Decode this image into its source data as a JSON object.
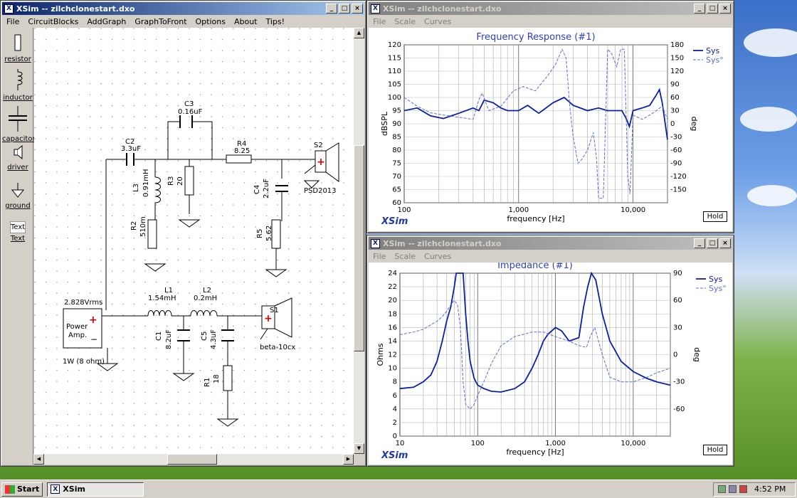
{
  "schematic_window": {
    "title": "XSim -- zilchclonestart.dxo",
    "menu": [
      "File",
      "CircuitBlocks",
      "AddGraph",
      "GraphToFront",
      "Options",
      "About",
      "Tips!"
    ],
    "palette": [
      "resistor",
      "inductor",
      "capacitor",
      "driver",
      "ground",
      "Text"
    ],
    "palette_text_box": "Text",
    "components": {
      "C2": {
        "name": "C2",
        "value": "3.3uF"
      },
      "C3": {
        "name": "C3",
        "value": "0.16uF"
      },
      "R4": {
        "name": "R4",
        "value": "8.25"
      },
      "L3": {
        "name": "L3",
        "value": "0.91mH"
      },
      "R3": {
        "name": "R3",
        "value": "20"
      },
      "R2": {
        "name": "R2",
        "value": "510m"
      },
      "C4": {
        "name": "C4",
        "value": "2.2uF"
      },
      "R5": {
        "name": "R5",
        "value": "5.62"
      },
      "S2": {
        "name": "S2",
        "value": "PSD2013"
      },
      "L1": {
        "name": "L1",
        "value": "1.54mH"
      },
      "L2": {
        "name": "L2",
        "value": "0.2mH"
      },
      "C1": {
        "name": "C1",
        "value": "8.2uF"
      },
      "C5": {
        "name": "C5",
        "value": "4.3uF"
      },
      "R1": {
        "name": "R1",
        "value": "18"
      },
      "S1": {
        "name": "S1",
        "value": "beta-10cx"
      }
    },
    "amp": {
      "voltage": "2.828Vrms",
      "label1": "Power",
      "label2": "Amp.",
      "rating": "1W (8 ohm)",
      "plus": "+",
      "minus": "−"
    }
  },
  "freq_window": {
    "title": "XSim -- zilchclonestart.dxo",
    "menu": [
      "File",
      "Scale",
      "Curves"
    ],
    "hold": "Hold",
    "logo": "XSim"
  },
  "imp_window": {
    "title": "XSim -- zilchclonestart.dxo",
    "menu": [
      "File",
      "Scale",
      "Curves"
    ],
    "hold": "Hold",
    "logo": "XSim"
  },
  "taskbar": {
    "start": "Start",
    "task": "XSim",
    "clock": "4:52 PM"
  },
  "chart_data": [
    {
      "type": "line",
      "title": "Frequency Response (#1)",
      "xlabel": "frequency [Hz]",
      "ylabel": "dBSPL",
      "y2label": "deg",
      "xscale": "log",
      "xlim": [
        100,
        20000
      ],
      "ylim": [
        60,
        120
      ],
      "y2lim": [
        -180,
        180
      ],
      "x_ticks": [
        "100",
        "1,000",
        "10,000"
      ],
      "y_ticks": [
        "60",
        "65",
        "70",
        "75",
        "80",
        "85",
        "90",
        "95",
        "100",
        "105",
        "110",
        "115",
        "120"
      ],
      "y2_ticks": [
        "-150",
        "-120",
        "-90",
        "-60",
        "-30",
        "0",
        "30",
        "60",
        "90",
        "120",
        "150",
        "180"
      ],
      "legend_position": "top-right",
      "series": [
        {
          "name": "Sys",
          "axis": "left",
          "style": "solid",
          "x": [
            100,
            130,
            170,
            220,
            300,
            400,
            450,
            500,
            600,
            700,
            800,
            1000,
            1200,
            1500,
            2000,
            2500,
            3000,
            4000,
            5000,
            6000,
            7000,
            8000,
            8700,
            9300,
            10000,
            12000,
            14000,
            16000,
            17000,
            18000,
            20000
          ],
          "y": [
            95,
            96,
            93,
            92,
            94,
            96,
            95,
            99,
            98,
            96,
            95,
            95,
            97,
            94,
            98,
            100,
            97,
            95,
            96,
            95,
            95,
            95,
            92,
            89,
            95,
            96,
            97,
            101,
            103,
            98,
            84
          ]
        },
        {
          "name": "Sys°",
          "axis": "right",
          "style": "dashed",
          "x": [
            100,
            130,
            170,
            220,
            300,
            400,
            450,
            480,
            550,
            700,
            900,
            1100,
            1400,
            1800,
            2100,
            2400,
            2600,
            2800,
            3000,
            3300,
            3600,
            4000,
            4500,
            4800,
            5000,
            5500,
            6000,
            6500,
            7200,
            7800,
            8400,
            9000,
            9400,
            10000,
            12000,
            14000,
            16000,
            18000,
            20000
          ],
          "y": [
            60,
            40,
            25,
            20,
            15,
            10,
            55,
            70,
            30,
            40,
            75,
            85,
            75,
            110,
            135,
            170,
            150,
            40,
            -30,
            -90,
            -80,
            -60,
            -20,
            -80,
            -170,
            -170,
            170,
            160,
            130,
            170,
            170,
            -120,
            -160,
            20,
            10,
            20,
            30,
            40,
            10
          ]
        }
      ]
    },
    {
      "type": "line",
      "title": "Impedance (#1)",
      "xlabel": "frequency [Hz]",
      "ylabel": "Ohms",
      "y2label": "deg",
      "xscale": "log",
      "xlim": [
        10,
        30000
      ],
      "ylim": [
        0,
        24
      ],
      "y2lim": [
        -90,
        90
      ],
      "x_ticks": [
        "10",
        "100",
        "1,000",
        "10,000"
      ],
      "y_ticks": [
        "0",
        "2",
        "4",
        "6",
        "8",
        "10",
        "12",
        "14",
        "16",
        "18",
        "20",
        "22",
        "24"
      ],
      "y2_ticks": [
        "-60",
        "-30",
        "0",
        "30",
        "60",
        "90"
      ],
      "legend_position": "top-right",
      "series": [
        {
          "name": "Sys",
          "axis": "left",
          "style": "solid",
          "x": [
            10,
            15,
            20,
            25,
            30,
            35,
            40,
            45,
            50,
            53,
            55,
            60,
            65,
            70,
            75,
            80,
            90,
            100,
            120,
            150,
            200,
            300,
            400,
            500,
            600,
            700,
            800,
            1000,
            1200,
            1500,
            2000,
            2300,
            2600,
            2900,
            3300,
            4000,
            5000,
            7000,
            10000,
            15000,
            20000,
            30000
          ],
          "y": [
            7,
            7.2,
            8,
            9,
            11,
            14,
            17,
            19,
            22,
            24,
            24,
            24,
            24,
            18,
            14,
            11,
            8.5,
            7.5,
            7,
            6.6,
            6.5,
            7,
            8,
            10,
            12,
            14,
            15,
            16,
            15.5,
            14,
            14.5,
            19,
            22,
            24,
            23,
            18,
            14,
            11,
            9.5,
            8.5,
            8,
            7.5
          ]
        },
        {
          "name": "Sys°",
          "axis": "right",
          "style": "dashed",
          "x": [
            10,
            15,
            20,
            25,
            30,
            35,
            40,
            45,
            50,
            55,
            60,
            65,
            70,
            80,
            90,
            100,
            120,
            150,
            200,
            300,
            500,
            700,
            1000,
            1500,
            2000,
            2500,
            2800,
            3200,
            4000,
            5000,
            7000,
            10000,
            15000,
            20000,
            30000
          ],
          "y": [
            22,
            25,
            28,
            33,
            37,
            42,
            48,
            55,
            60,
            55,
            30,
            -30,
            -55,
            -60,
            -55,
            -45,
            -30,
            -10,
            10,
            20,
            25,
            25,
            20,
            15,
            10,
            8,
            20,
            30,
            0,
            -25,
            -30,
            -30,
            -25,
            -20,
            -15
          ]
        }
      ]
    }
  ]
}
